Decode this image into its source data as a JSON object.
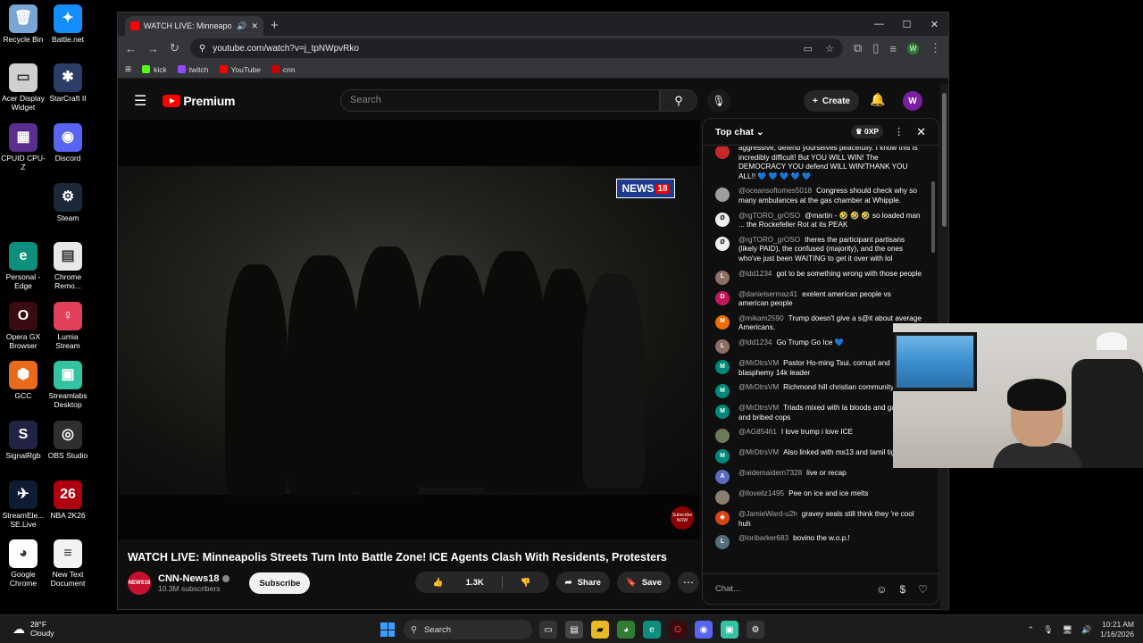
{
  "desktop_icons": [
    {
      "label": "Recycle Bin",
      "color": "#7aa6d6",
      "glyph": "🗑"
    },
    {
      "label": "Battle.net",
      "color": "#148eff",
      "glyph": "✦"
    },
    {
      "label": "Acer Display Widget",
      "color": "#cfcfcf",
      "glyph": "▭"
    },
    {
      "label": "StarCraft II",
      "color": "#2a3d66",
      "glyph": "✱"
    },
    {
      "label": "CPUID CPU-Z",
      "color": "#5b2d8e",
      "glyph": "▦"
    },
    {
      "label": "Discord",
      "color": "#5865f2",
      "glyph": "◉"
    },
    {
      "label": "Steam",
      "color": "#1b2838",
      "glyph": "⚙"
    },
    {
      "label": "Personal - Edge",
      "color": "#0c8f7c",
      "glyph": "e"
    },
    {
      "label": "Chrome Remo...",
      "color": "#e8e8e8",
      "glyph": "▤"
    },
    {
      "label": "Opera GX Browser",
      "color": "#3a0a10",
      "glyph": "O"
    },
    {
      "label": "Lumia Stream",
      "color": "#e0405a",
      "glyph": "♀"
    },
    {
      "label": "GCC",
      "color": "#e86a1a",
      "glyph": "⬢"
    },
    {
      "label": "Streamlabs Desktop",
      "color": "#31c3a2",
      "glyph": "▣"
    },
    {
      "label": "SignalRgb",
      "color": "#222244",
      "glyph": "S"
    },
    {
      "label": "OBS Studio",
      "color": "#302e31",
      "glyph": "◎"
    },
    {
      "label": "StreamEle... SE.Live",
      "color": "#0e1c33",
      "glyph": "✈"
    },
    {
      "label": "NBA 2K26",
      "color": "#b00010",
      "glyph": "26"
    },
    {
      "label": "Google Chrome",
      "color": "#ffffff",
      "glyph": "◕"
    },
    {
      "label": "New Text Document",
      "color": "#f2f2f2",
      "glyph": "≡"
    }
  ],
  "browser": {
    "tab_title": "WATCH LIVE: Minneapolis S",
    "url": "youtube.com/watch?v=j_tpNWpvRko",
    "bookmarks": [
      {
        "label": "kick",
        "color": "#53fc18"
      },
      {
        "label": "twitch",
        "color": "#9146ff"
      },
      {
        "label": "YouTube",
        "color": "#ff0000"
      },
      {
        "label": "cnn",
        "color": "#cc0000"
      }
    ],
    "profile_initial": "W"
  },
  "youtube": {
    "logo_text": "Premium",
    "search_placeholder": "Search",
    "create_label": "Create",
    "avatar_initial": "W"
  },
  "video": {
    "overlay_logo": "NEWS",
    "overlay_logo_num": "18",
    "subscribe_badge": "Subscribe NOW",
    "title": "WATCH LIVE: Minneapolis Streets Turn Into Battle Zone! ICE Agents Clash With Residents, Protesters",
    "channel_name": "CNN-News18",
    "channel_logo_text": "NEWS18",
    "subscribers": "10.3M subscribers",
    "subscribe_label": "Subscribe",
    "likes": "1.3K",
    "share_label": "Share",
    "save_label": "Save"
  },
  "chat": {
    "title": "Top chat",
    "xp": "0XP",
    "input_placeholder": "Chat...",
    "messages": [
      {
        "author": "",
        "text": "aggressive, defend yourselves peacefully. I know this is incredibly difficult! But YOU WILL WIN! The DEMOCRACY YOU defend WILL WIN!THANK YOU ALL!! 💙 💙 💙 💙 💙",
        "avatar": "",
        "color": "#c62828"
      },
      {
        "author": "@oceansoftomes5018",
        "text": "Congress should check why so many ambulances at the gas chamber at Whipple.",
        "avatar": "",
        "color": "#9e9e9e"
      },
      {
        "author": "@rgTORO_grOSO",
        "text": "@martin - 🤣 🤣 🤣 so loaded man ... the Rockefeller Rot at its PEAK",
        "avatar": "Ø",
        "color": "#eeeeee"
      },
      {
        "author": "@rgTORO_grOSO",
        "text": "theres the participant partisans (likely PAID), the confused (majority), and the ones who've just been WAITING to get it over with lol",
        "avatar": "Ø",
        "color": "#eeeeee"
      },
      {
        "author": "@ldd1234",
        "text": "got to be something wrong with those people",
        "avatar": "L",
        "color": "#8d6e63"
      },
      {
        "author": "@danielsermaz41",
        "text": "exelent american people vs american people",
        "avatar": "D",
        "color": "#c2185b"
      },
      {
        "author": "@mikam2590",
        "text": "Trump doesn't give a s@it about average Americans.",
        "avatar": "M",
        "color": "#ef6c00"
      },
      {
        "author": "@ldd1234",
        "text": "Go Trump Go Ice 💙",
        "avatar": "L",
        "color": "#8d6e63"
      },
      {
        "author": "@MrDtrsVM",
        "text": "Pastor Ho-ming Tsui, corrupt and blasphemy 14k leader",
        "avatar": "M",
        "color": "#00897b"
      },
      {
        "author": "@MrDtrsVM",
        "text": "Richmond hill christian community church",
        "avatar": "M",
        "color": "#00897b"
      },
      {
        "author": "@MrDtrsVM",
        "text": "Triads mixed with la bloods and gangs and bribed cops",
        "avatar": "M",
        "color": "#00897b"
      },
      {
        "author": "@AG85461",
        "text": "I love trump i love ICE",
        "avatar": "",
        "color": "#6d7a5a"
      },
      {
        "author": "@MrDtrsVM",
        "text": "Also linked with ms13 and tamil tigers",
        "avatar": "M",
        "color": "#00897b"
      },
      {
        "author": "@aidemaidem7328",
        "text": "live or recap",
        "avatar": "A",
        "color": "#5c6bc0"
      },
      {
        "author": "@lloveliz1495",
        "text": "Pee on ice and ice melts",
        "avatar": "",
        "color": "#8a7e72"
      },
      {
        "author": "@JamieWard-u2h",
        "text": "gravey seals still think they 're cool huh",
        "avatar": "◈",
        "color": "#d84315"
      },
      {
        "author": "@loribarker683",
        "text": "bovino the w.o.p.!",
        "avatar": "L",
        "color": "#546e7a"
      }
    ]
  },
  "taskbar": {
    "temp": "28°F",
    "condition": "Cloudy",
    "search_label": "Search",
    "time": "10:21 AM",
    "date": "1/16/2026"
  }
}
